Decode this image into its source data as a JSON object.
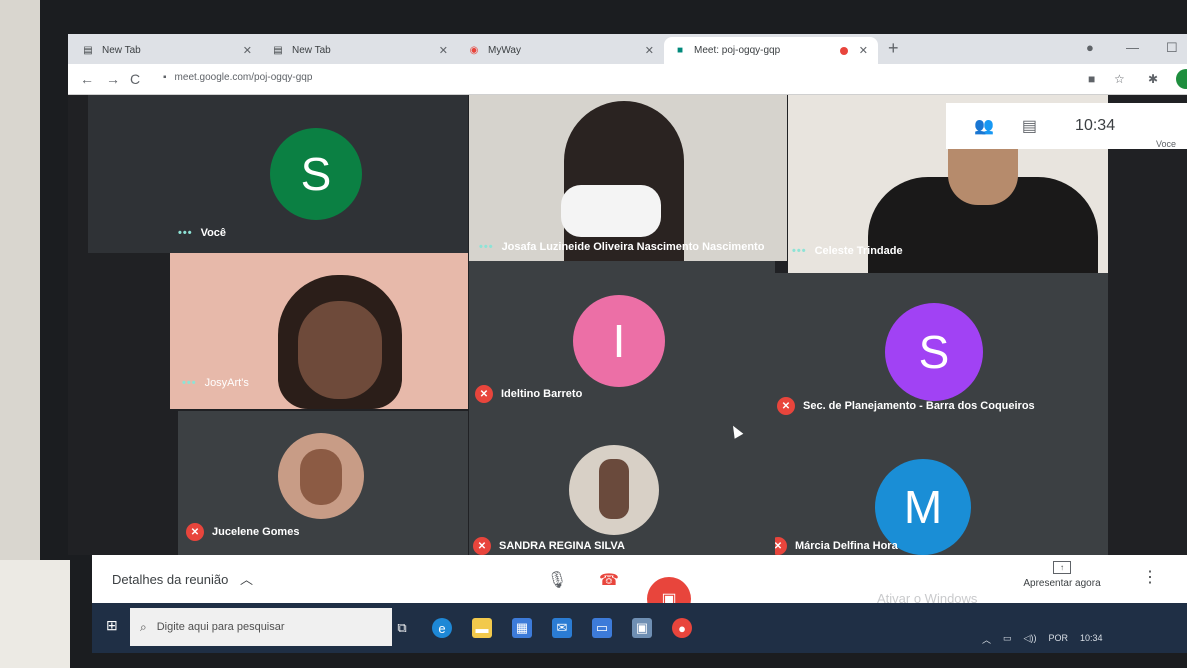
{
  "browser": {
    "tabs": [
      {
        "title": "New Tab",
        "icon": "page-icon",
        "active": false
      },
      {
        "title": "New Tab",
        "icon": "page-icon",
        "active": false
      },
      {
        "title": "MyWay",
        "icon": "myway-icon",
        "active": false
      },
      {
        "title": "Meet: poj-ogqy-gqp",
        "icon": "meet-icon",
        "active": true,
        "recording": true
      }
    ],
    "url": "meet.google.com/poj-ogqy-gqp"
  },
  "meet": {
    "top_panel": {
      "clock": "10:34",
      "self_label": "Voce"
    },
    "participants": [
      {
        "name": "Você",
        "avatar_letter": "S",
        "avatar_color": "#0b8043",
        "muted": false
      },
      {
        "name": "Josafa Luzineide Oliveira Nascimento Nascimento",
        "muted": false
      },
      {
        "name": "Celeste Trindade",
        "muted": false
      },
      {
        "name": "JosyArt's",
        "muted": false
      },
      {
        "name": "Ideltino Barreto",
        "avatar_letter": "I",
        "avatar_color": "#ec6fa6",
        "muted": true
      },
      {
        "name": "Sec. de Planejamento - Barra dos Coqueiros",
        "avatar_letter": "S",
        "avatar_color": "#a142f4",
        "muted": true
      },
      {
        "name": "Jucelene Gomes",
        "muted": true
      },
      {
        "name": "SANDRA REGINA SILVA",
        "muted": true
      },
      {
        "name": "Márcia Delfina Hora",
        "avatar_letter": "M",
        "avatar_color": "#1a8ed6",
        "muted": true
      }
    ],
    "bottom": {
      "details_label": "Detalhes da reunião",
      "present_label": "Apresentar agora",
      "watermark": "Ativar o Windows"
    },
    "colors": {
      "hangup": "#e8453c",
      "accent": "#1a73e8"
    }
  },
  "taskbar": {
    "search_placeholder": "Digite aqui para pesquisar",
    "lang": "POR",
    "time": "10:34"
  }
}
